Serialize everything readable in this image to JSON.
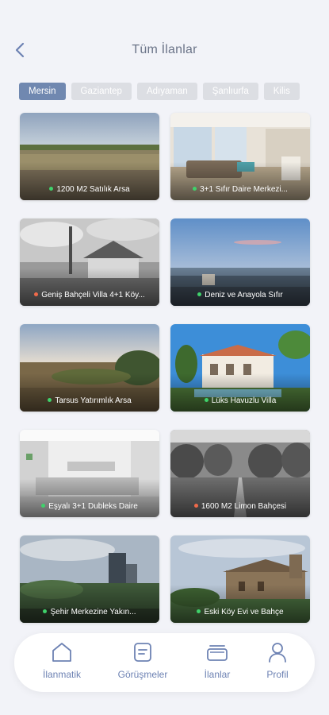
{
  "header": {
    "title": "Tüm İlanlar"
  },
  "cities": [
    {
      "label": "Mersin",
      "active": true
    },
    {
      "label": "Gaziantep",
      "active": false
    },
    {
      "label": "Adıyaman",
      "active": false
    },
    {
      "label": "Şanlıurfa",
      "active": false
    },
    {
      "label": "Kilis",
      "active": false
    }
  ],
  "listings": [
    {
      "title": "1200 M2 Satılık Arsa",
      "status": "green",
      "image": "field"
    },
    {
      "title": "3+1 Sıfır Daire Merkezi...",
      "status": "green",
      "image": "living-room"
    },
    {
      "title": "Geniş Bahçeli Villa 4+1 Köy...",
      "status": "red",
      "image": "villa-bw"
    },
    {
      "title": "Deniz ve Anayola Sıfır",
      "status": "green",
      "image": "sea"
    },
    {
      "title": "Tarsus Yatırımlık Arsa",
      "status": "green",
      "image": "hill-land"
    },
    {
      "title": "Lüks Havuzlu Villa",
      "status": "green",
      "image": "pool-villa"
    },
    {
      "title": "Eşyalı 3+1 Dubleks Daire",
      "status": "green",
      "image": "kitchen"
    },
    {
      "title": "1600 M2 Limon Bahçesi",
      "status": "red",
      "image": "orchard"
    },
    {
      "title": "Şehir Merkezine Yakın...",
      "status": "green",
      "image": "city"
    },
    {
      "title": "Eski Köy Evi ve Bahçe",
      "status": "green",
      "image": "stone-house"
    }
  ],
  "nav": [
    {
      "label": "İlanmatik",
      "icon": "home-icon"
    },
    {
      "label": "Görüşmeler",
      "icon": "chat-icon"
    },
    {
      "label": "İlanlar",
      "icon": "listings-icon"
    },
    {
      "label": "Profil",
      "icon": "user-icon"
    }
  ],
  "colors": {
    "background": "#f2f3f8",
    "accent": "#7088b0",
    "chip_inactive": "#dcdee3",
    "nav_text": "#6d82b3",
    "status_green": "#3fd26b",
    "status_red": "#f06a4a"
  }
}
